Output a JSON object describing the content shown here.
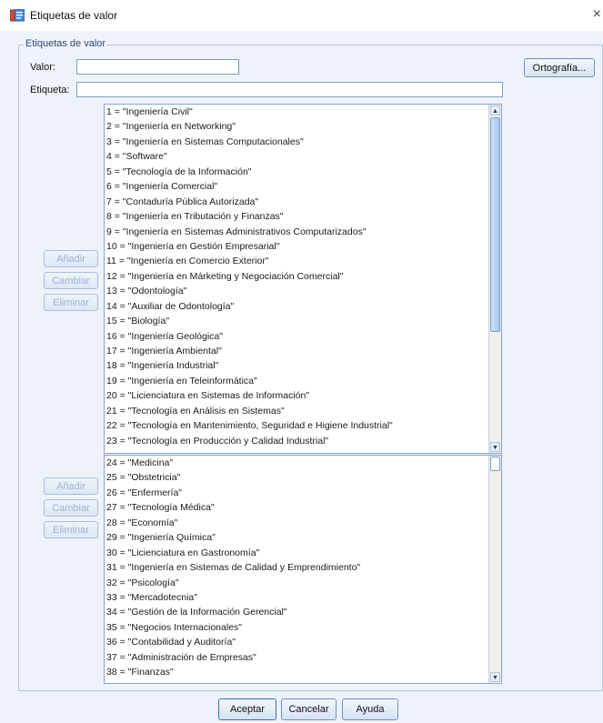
{
  "window": {
    "title": "Etiquetas de valor",
    "close_glyph": "×"
  },
  "group": {
    "legend": "Etiquetas de valor"
  },
  "form": {
    "valor_label": "Valor:",
    "valor_value": "",
    "etiqueta_label": "Etiqueta:",
    "etiqueta_value": "",
    "spelling_button": "Ortografía..."
  },
  "side_buttons": {
    "add": "Añadir",
    "change": "Cambiar",
    "remove": "Eliminar"
  },
  "list_a": [
    "1 = \"Ingeniería Civil\"",
    "2 = \"Ingeniería en Networking\"",
    "3 = \"Ingeniería en Sistemas Computacionales\"",
    "4 = \"Software\"",
    "5 = \"Tecnología de la Información\"",
    "6 = \"Ingeniería Comercial\"",
    "7 = \"Contaduría Pública Autorizada\"",
    "8 = \"Ingeniería en Tributación y Finanzas\"",
    "9 = \"Ingeniería en Sistemas Administrativos Computarizados\"",
    "10 = \"Ingeniería en Gestión Empresarial\"",
    "11 = \"Ingeniería en Comercio Exterior\"",
    "12 = \"Ingeniería en Márketing y Negociación Comercial\"",
    "13 = \"Odontología\"",
    "14 = \"Auxiliar de Odontología\"",
    "15 = \"Biología\"",
    "16 = \"Ingeniería Geológica\"",
    "17 = \"Ingeniería Ambiental\"",
    "18 = \"Ingeniería Industrial\"",
    "19 = \"Ingeniería en Teleinformática\"",
    "20 = \"Licienciatura en Sistemas de Información\"",
    "21 = \"Tecnología en Análisis en Sistemas\"",
    "22 = \"Tecnología en Mantenimiento, Seguridad e Higiene Industrial\"",
    "23 = \"Tecnología en Producción y Calidad Industrial\""
  ],
  "list_b": [
    "24 = \"Medicina\"",
    "25 = \"Obstetricia\"",
    "26 = \"Enfermería\"",
    "27 = \"Tecnología Médica\"",
    "28 = \"Economía\"",
    "29 = \"Ingeniería Química\"",
    "30 = \"Licienciatura en Gastronomía\"",
    "31 = \"Ingeniería en Sistemas de Calidad y Emprendimiento\"",
    "32 = \"Psicología\"",
    "33 = \"Mercadotecnia\"",
    "34 = \"Gestión de la Información Gerencial\"",
    "35 = \"Negocios Internacionales\"",
    "36 = \"Contabilidad y Auditoría\"",
    "37 = \"Administración de Empresas\"",
    "38 = \"Finanzas\""
  ],
  "footer": {
    "ok": "Aceptar",
    "cancel": "Cancelar",
    "help": "Ayuda"
  },
  "icons": {
    "app": "value-labels-icon",
    "close": "close-icon"
  },
  "colors": {
    "background": "#eef3fa",
    "legend": "#2d4a77",
    "button_border": "#6f90c0"
  }
}
